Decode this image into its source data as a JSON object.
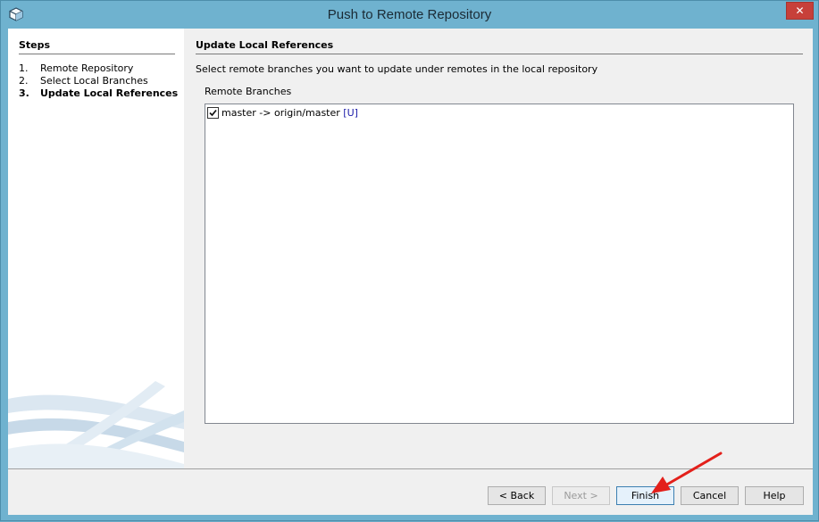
{
  "window": {
    "title": "Push to Remote Repository",
    "close_glyph": "✕",
    "app_icon": "cube-icon",
    "colors": {
      "frame": "#6fb2cf",
      "close": "#c7403a"
    }
  },
  "steps": {
    "header": "Steps",
    "items": [
      {
        "number": "1.",
        "label": "Remote Repository",
        "current": false
      },
      {
        "number": "2.",
        "label": "Select Local Branches",
        "current": false
      },
      {
        "number": "3.",
        "label": "Update Local References",
        "current": true
      }
    ]
  },
  "content": {
    "title": "Update Local References",
    "instruction": "Select remote branches you want to update under remotes in the local repository",
    "list_label": "Remote Branches",
    "branches": [
      {
        "checked": true,
        "text": "master -> origin/master",
        "tag": "[U]"
      }
    ]
  },
  "buttons": {
    "back": "< Back",
    "next": "Next >",
    "finish": "Finish",
    "cancel": "Cancel",
    "help": "Help"
  },
  "annotation": {
    "icon": "red-arrow-pointing-finish"
  }
}
